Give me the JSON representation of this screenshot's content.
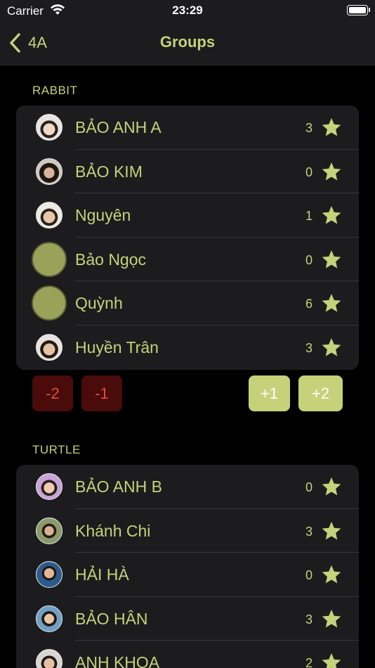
{
  "status": {
    "carrier": "Carrier",
    "time": "23:29"
  },
  "nav": {
    "back_label": "4A",
    "title": "Groups"
  },
  "groups": [
    {
      "name": "RABBIT",
      "students": [
        {
          "name": "BẢO ANH A",
          "score": "3",
          "avatar": "photo"
        },
        {
          "name": "BẢO KIM",
          "score": "0",
          "avatar": "photo"
        },
        {
          "name": "Nguyên",
          "score": "1",
          "avatar": "photo"
        },
        {
          "name": "Bảo Ngọc",
          "score": "0",
          "avatar": "placeholder"
        },
        {
          "name": "Quỳnh",
          "score": "6",
          "avatar": "placeholder"
        },
        {
          "name": "Huyền Trân",
          "score": "3",
          "avatar": "photo"
        }
      ],
      "buttons": [
        "-2",
        "-1",
        "+1",
        "+2"
      ]
    },
    {
      "name": "TURTLE",
      "students": [
        {
          "name": "BẢO ANH B",
          "score": "0",
          "avatar": "photo"
        },
        {
          "name": "Khánh Chi",
          "score": "3",
          "avatar": "photo"
        },
        {
          "name": "HẢI HÀ",
          "score": "0",
          "avatar": "photo"
        },
        {
          "name": "BẢO HÂN",
          "score": "3",
          "avatar": "photo"
        },
        {
          "name": "ANH KHOA",
          "score": "2",
          "avatar": "photo"
        }
      ]
    }
  ],
  "colors": {
    "accent": "#c5d27a",
    "negative": "#e34b3b",
    "negative_bg": "#4a0b0b",
    "card": "#1c1c1e"
  },
  "icons": {
    "back": "chevron-left-icon",
    "star": "star-icon",
    "wifi": "wifi-icon",
    "battery": "battery-icon"
  }
}
